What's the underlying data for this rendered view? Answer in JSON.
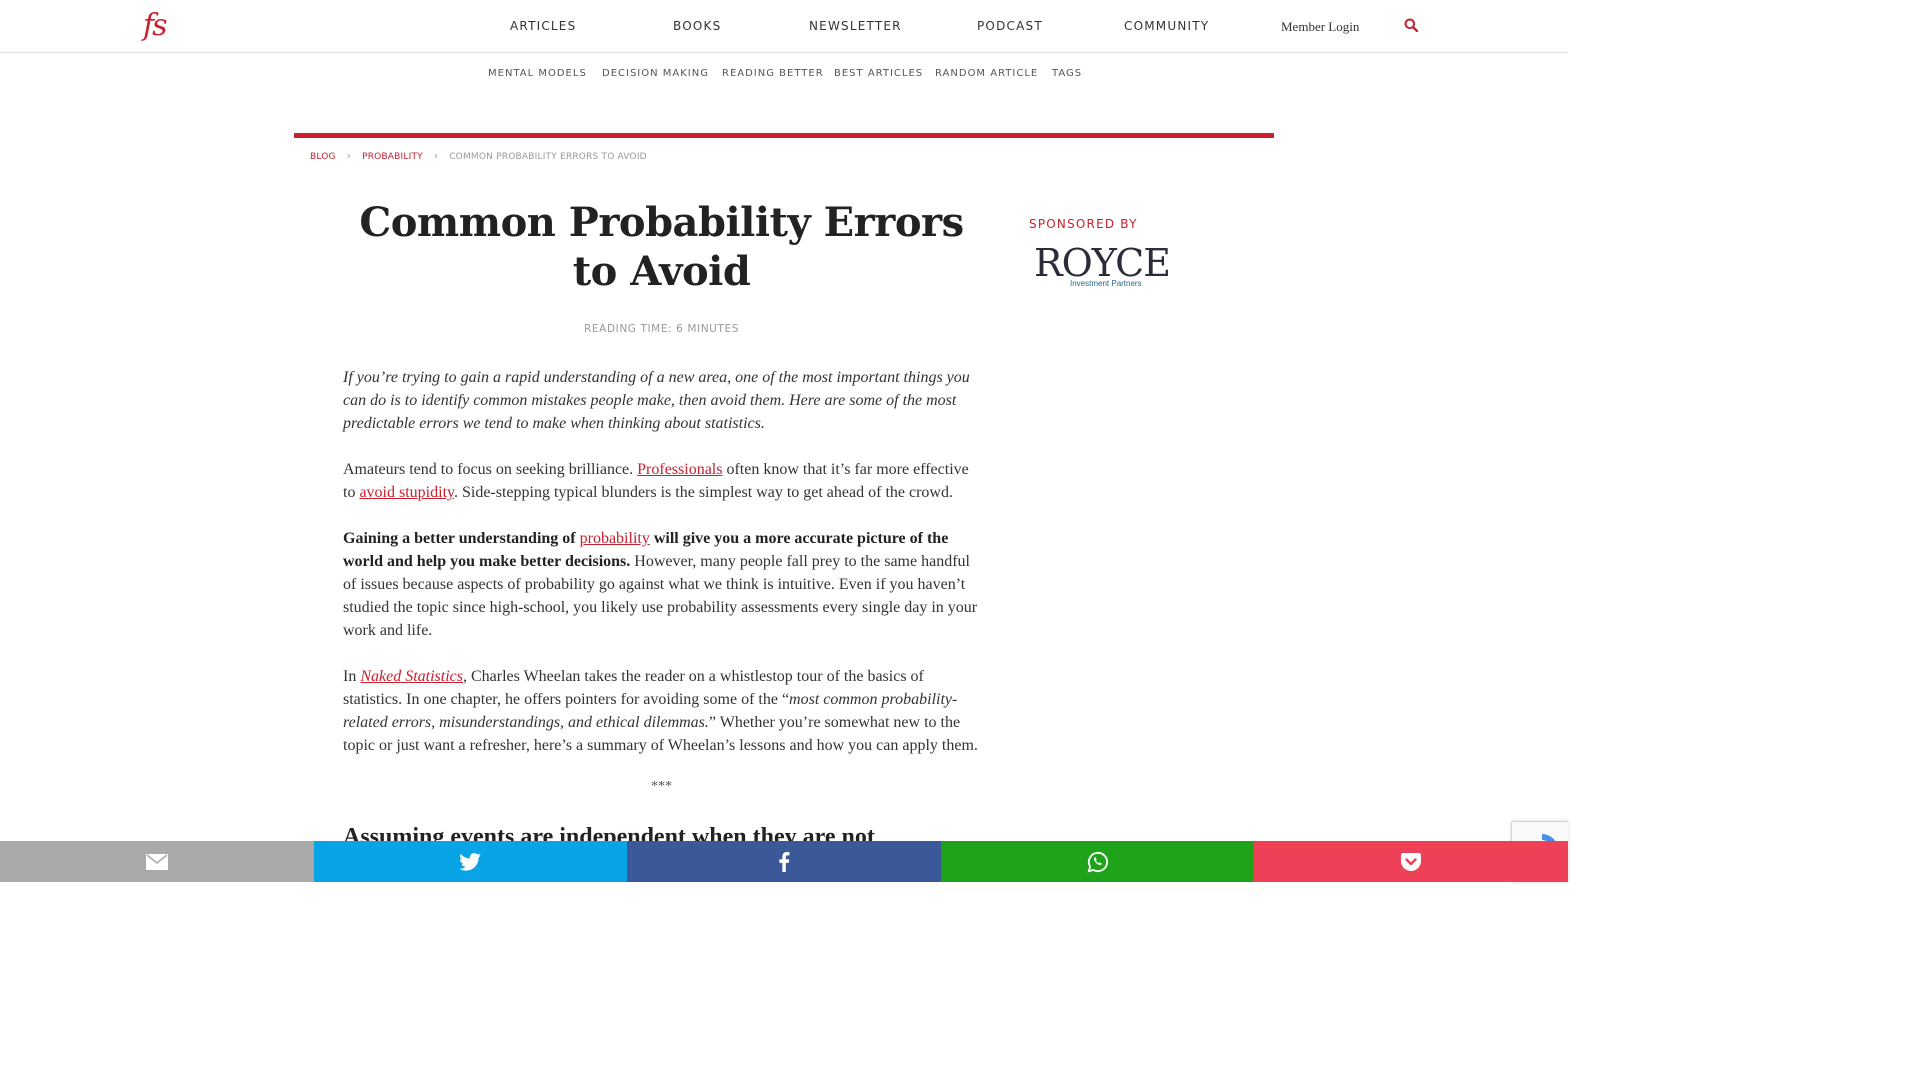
{
  "logo": {
    "text": "fs"
  },
  "nav": {
    "items": [
      "ARTICLES",
      "BOOKS",
      "NEWSLETTER",
      "PODCAST",
      "COMMUNITY"
    ],
    "member_login": "Member Login"
  },
  "subnav": {
    "items": [
      "MENTAL MODELS",
      "DECISION MAKING",
      "READING BETTER",
      "BEST ARTICLES",
      "RANDOM ARTICLE",
      "TAGS"
    ]
  },
  "breadcrumb": {
    "items": [
      "BLOG",
      "PROBABILITY"
    ],
    "current": "COMMON PROBABILITY ERRORS TO AVOID",
    "separator": "›"
  },
  "article": {
    "title": "Common Probability Errors to Avoid",
    "reading_time": "READING TIME: 6 MINUTES",
    "intro": "If you’re trying to gain a rapid understanding of a new area, one of the most important things you can do is to identify common mistakes people make, then avoid them. Here are some of the most predictable errors we tend to make when thinking about statistics.",
    "p1": {
      "a": "Amateurs tend to focus on seeking brilliance. ",
      "link1": "Professionals",
      "b": " often know that it’s far more effective to ",
      "link2": "avoid stupidity",
      "c": ". Side-stepping typical blunders is the simplest way to get ahead of the crowd."
    },
    "p2": {
      "bold_a": "Gaining a better understanding of ",
      "link": "probability",
      "bold_b": " will give you a more accurate picture of the world and help you make better decisions.",
      "rest": " However, many people fall prey to the same handful of issues because aspects of probability go against what we think is intuitive. Even if you haven’t studied the topic since high-school, you likely use probability assessments every single day in your work and life."
    },
    "p3": {
      "a": "In ",
      "link": "Naked Statistics",
      "b": ", Charles Wheelan takes the reader on a whistlestop tour of the basics of statistics. In one chapter, he offers pointers for avoiding some of the “",
      "quote": "most common probability-related errors, misunderstandings, and ethical dilemmas.",
      "c": "” Whether you’re somewhat new to the topic or just want a refresher, here’s a summary of Wheelan’s lessons and how you can apply them."
    },
    "separator": "***",
    "heading": "Assuming events are independent when they are not"
  },
  "sidebar": {
    "sponsored_label": "SPONSORED BY",
    "sponsor_logo_text": "ROYCE",
    "sponsor_logo_sub": "Investment Partners"
  },
  "share": {
    "buttons": [
      "email-icon",
      "twitter-icon",
      "facebook-icon",
      "whatsapp-icon",
      "pocket-icon"
    ],
    "colors": [
      "#a9a9a9",
      "#08a4e6",
      "#3b5998",
      "#1fa31a",
      "#ee4056"
    ]
  },
  "colors": {
    "accent": "#c8202e"
  }
}
